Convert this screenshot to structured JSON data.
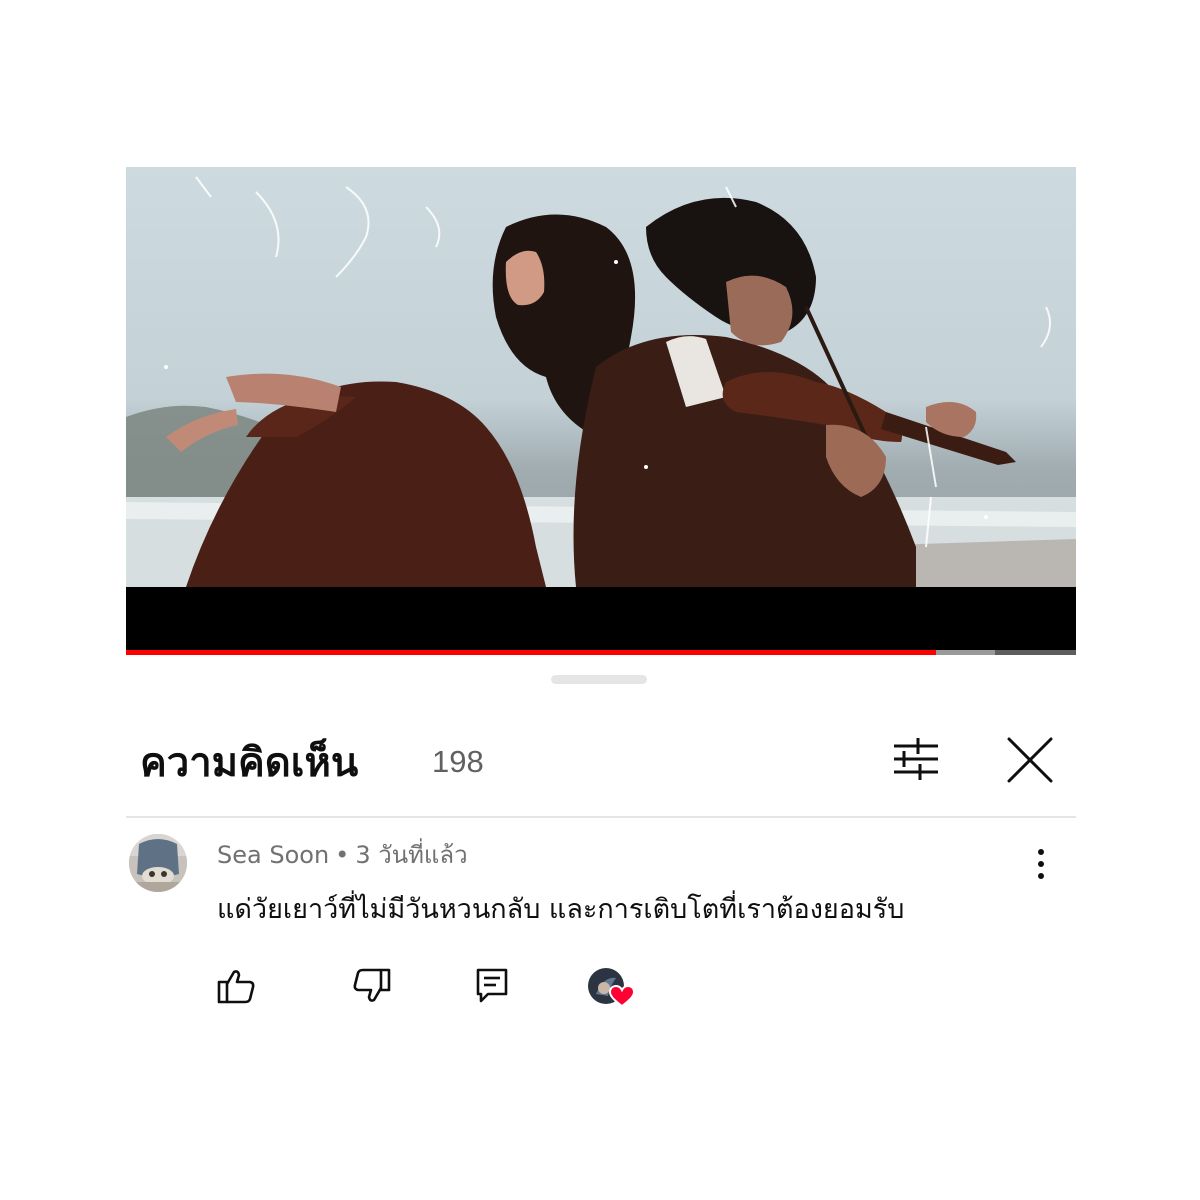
{
  "video": {
    "progress_played": 0.853,
    "progress_buffered": 0.915,
    "progress_color": "#ff0000"
  },
  "comments": {
    "title": "ความคิดเห็น",
    "count": "198"
  },
  "icons": {
    "filter": "filter-sliders-icon",
    "close": "close-icon",
    "more": "more-vertical-icon",
    "like": "thumbs-up-icon",
    "dislike": "thumbs-down-icon",
    "reply": "reply-comment-icon",
    "creator_heart": "creator-heart-icon"
  },
  "comment": {
    "author": "Sea Soon",
    "separator": "•",
    "time": "3 วันที่แล้ว",
    "text": "แด่วัยเยาว์ที่ไม่มีวันหวนกลับ และการเติบโตที่เราต้องยอมรับ"
  },
  "colors": {
    "heart": "#ff0033",
    "text_primary": "#0f0f0f",
    "text_secondary": "#606060"
  }
}
